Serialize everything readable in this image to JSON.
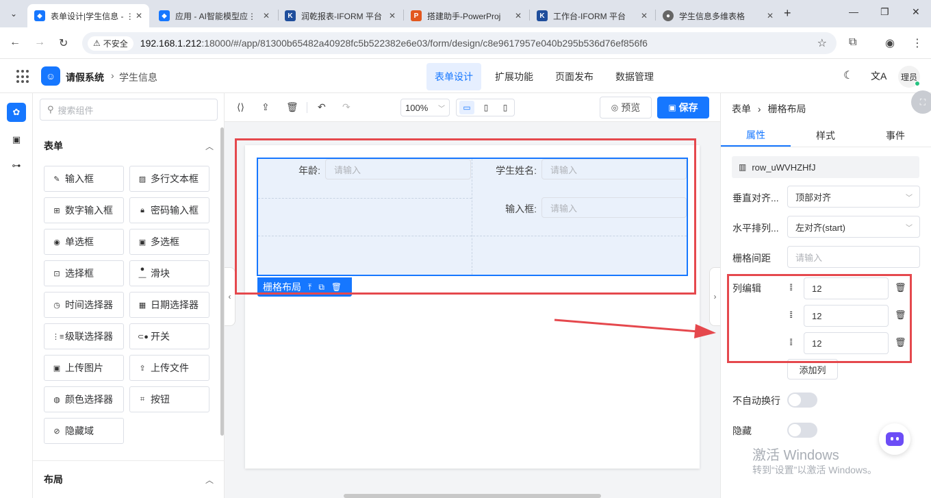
{
  "browser": {
    "tabs": [
      {
        "title": "表单设计|学生信息 - ⋮",
        "active": true,
        "icon_color": "#1677ff"
      },
      {
        "title": "应用 - AI智能模型应⋮",
        "active": false,
        "icon_color": "#1677ff"
      },
      {
        "title": "润乾报表-IFORM 平台",
        "active": false,
        "icon_color": "#1f4e9c"
      },
      {
        "title": "搭建助手-PowerProj",
        "active": false,
        "icon_color": "#e2571e"
      },
      {
        "title": "工作台-IFORM 平台",
        "active": false,
        "icon_color": "#1f4e9c"
      },
      {
        "title": "学生信息多维表格",
        "active": false,
        "icon_color": "#666666"
      }
    ],
    "insecure_label": "不安全",
    "url_host": "192.168.1.212",
    "url_path": ":18000/#/app/81300b65482a40928fc5b522382e6e03/form/design/c8e9617957e040b295b536d76ef856f6"
  },
  "app": {
    "name": "请假系统",
    "breadcrumb": "学生信息",
    "menu": [
      "表单设计",
      "扩展功能",
      "页面发布",
      "数据管理"
    ],
    "active_menu": 0,
    "user": "理员"
  },
  "components": {
    "search_placeholder": "搜索组件",
    "section_form": "表单",
    "items": [
      {
        "label": "输入框",
        "icon": "edit-icon"
      },
      {
        "label": "多行文本框",
        "icon": "textarea-icon"
      },
      {
        "label": "数字输入框",
        "icon": "number-icon"
      },
      {
        "label": "密码输入框",
        "icon": "lock-icon"
      },
      {
        "label": "单选框",
        "icon": "radio-icon"
      },
      {
        "label": "多选框",
        "icon": "checkbox-icon"
      },
      {
        "label": "选择框",
        "icon": "select-icon"
      },
      {
        "label": "滑块",
        "icon": "slider-icon"
      },
      {
        "label": "时间选择器",
        "icon": "clock-icon"
      },
      {
        "label": "日期选择器",
        "icon": "calendar-icon"
      },
      {
        "label": "级联选择器",
        "icon": "cascader-icon"
      },
      {
        "label": "开关",
        "icon": "switch-icon"
      },
      {
        "label": "上传图片",
        "icon": "image-icon"
      },
      {
        "label": "上传文件",
        "icon": "upload-icon"
      },
      {
        "label": "颜色选择器",
        "icon": "palette-icon"
      },
      {
        "label": "按钮",
        "icon": "button-icon"
      },
      {
        "label": "隐藏域",
        "icon": "eye-off-icon"
      }
    ],
    "section_layout": "布局"
  },
  "toolbar": {
    "zoom": "100%",
    "preview_label": "预览",
    "save_label": "保存"
  },
  "form": {
    "fields": [
      {
        "label": "年龄:",
        "placeholder": "请输入"
      },
      {
        "label": "学生姓名:",
        "placeholder": "请输入"
      },
      {
        "label": "输入框:",
        "placeholder": "请输入"
      }
    ],
    "grid_tag": "栅格布局"
  },
  "props": {
    "breadcrumb_root": "表单",
    "breadcrumb_current": "栅格布局",
    "tabs": [
      "属性",
      "样式",
      "事件"
    ],
    "active_tab": 0,
    "component_id": "row_uWVHZHfJ",
    "vertical_align_label": "垂直对齐...",
    "vertical_align_value": "顶部对齐",
    "horizontal_label": "水平排列...",
    "horizontal_value": "左对齐(start)",
    "gutter_label": "栅格间距",
    "gutter_placeholder": "请输入",
    "columns_label": "列编辑",
    "columns": [
      "12",
      "12",
      "12"
    ],
    "add_column": "添加列",
    "nowrap_label": "不自动换行",
    "nowrap": false,
    "hidden_label": "隐藏",
    "hidden": false
  },
  "watermark": {
    "line1": "激活 Windows",
    "line2": "转到“设置”以激活 Windows。"
  },
  "colors": {
    "primary": "#1677ff",
    "highlight": "#e5484d"
  }
}
